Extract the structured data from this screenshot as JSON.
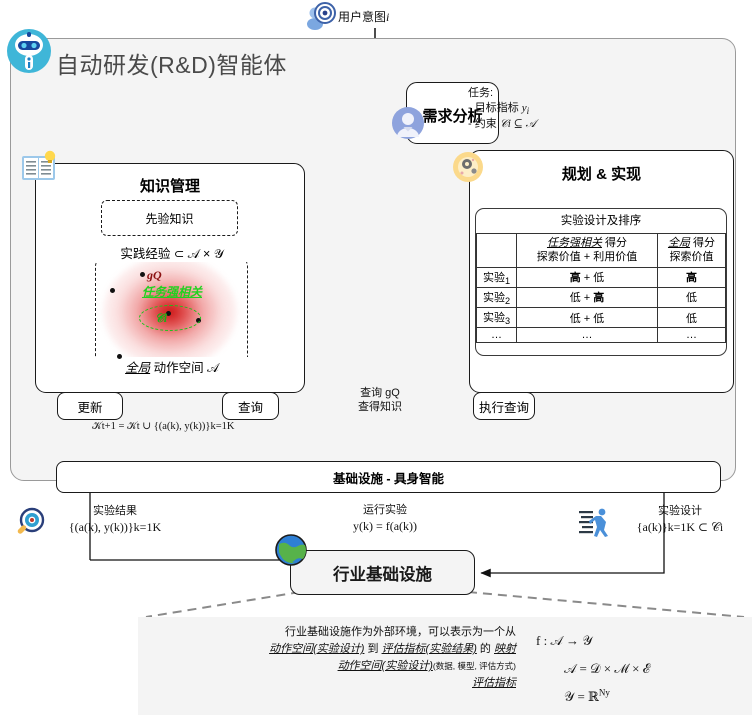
{
  "agent": {
    "title": "自动研发(R&D)智能体",
    "icon": "robot-icon"
  },
  "user_intent": {
    "label": "用户意图",
    "symbol": "i",
    "icon": "user-target-icon"
  },
  "requirement": {
    "title": "需求分析",
    "icon": "person-icon"
  },
  "task_note": {
    "line1": "任务:",
    "line2_prefix": "- 目标指标 ",
    "line2_math": "y",
    "line2_sub": "i",
    "line3_prefix": "- 约束 ",
    "line3_math": "𝒞i ⊆ 𝒜"
  },
  "knowledge": {
    "title": "知识管理",
    "icon": "book-idea-icon",
    "prior": "先验知识",
    "experience_label": "实践经验 ⊂ 𝒜 × 𝒴",
    "global_label_prefix": "全局",
    "global_label_rest": " 动作空间 𝒜",
    "task_relevant": "任务强相关",
    "constraint_symbol": "𝒞i",
    "gq_symbol": "gQ"
  },
  "actions": {
    "update": "更新",
    "query": "查询",
    "execute_query": "执行查询",
    "update_formula": "𝒦t+1 = 𝒦t ∪ {(a(k), y(k))}k=1K"
  },
  "planning": {
    "title": "规划 & 实现",
    "icon": "brain-gear-icon",
    "table": {
      "caption": "实验设计及排序",
      "headers": [
        "",
        {
          "line1_em": "任务强相关",
          "line1_rest": " 得分",
          "line2": "探索价值 + 利用价值"
        },
        {
          "line1_em": "全局",
          "line1_rest": " 得分",
          "line2": "探索价值"
        }
      ],
      "rows": [
        {
          "name": "实验",
          "sub": "1",
          "col1": [
            "高",
            "+",
            "低"
          ],
          "col1_bold": [
            true,
            false,
            false
          ],
          "col2": "高",
          "col2_bold": true
        },
        {
          "name": "实验",
          "sub": "2",
          "col1": [
            "低",
            "+",
            "高"
          ],
          "col1_bold": [
            false,
            false,
            true
          ],
          "col2": "低",
          "col2_bold": false
        },
        {
          "name": "实验",
          "sub": "3",
          "col1": [
            "低",
            "+",
            "低"
          ],
          "col1_bold": [
            false,
            false,
            false
          ],
          "col2": "低",
          "col2_bold": false
        },
        {
          "name": "…",
          "sub": "",
          "col1": [
            "…",
            "",
            ""
          ],
          "col1_bold": [
            false,
            false,
            false
          ],
          "col2": "…",
          "col2_bold": false
        }
      ]
    }
  },
  "edges": {
    "query_gq": "查询 gQ",
    "query_knowledge": "查得知识",
    "exp_result_label": "实验结果",
    "exp_result_math": "{(a(k), y(k))}k=1K",
    "run_exp_label": "运行实验",
    "run_exp_math": "y(k) = f(a(k))",
    "exp_design_label": "实验设计",
    "exp_design_math": "{a(k)}k=1K ⊂ 𝒞i"
  },
  "infra": {
    "label": "基础设施 - 具身智能"
  },
  "industry": {
    "label": "行业基础设施",
    "icon": "globe-icon"
  },
  "explain": {
    "line1": "行业基础设施作为外部环境，可以表示为一个从",
    "line2_a": "动作空间(实验设计)",
    "line2_b": " 到 ",
    "line2_c": "评估指标(实验结果)",
    "line2_d": " 的 ",
    "line2_e": "映射",
    "line3_a": "动作空间(实验设计)",
    "line3_b": "(数据, 模型, 评估方式)",
    "line4_a": "评估指标",
    "math1": "f : 𝒜 → 𝒴",
    "math2": "𝒜 = 𝒟 × ℳ × ℰ",
    "math3": "𝒴 = ℝ",
    "math3_sup": "Ny"
  },
  "icons": {
    "magnifier": "magnifier-eye-icon",
    "runner": "runner-icon"
  },
  "colors": {
    "panel_bg": "#f4f4f4",
    "accent_red": "#8b1111",
    "accent_green": "#1fd21f",
    "stroke": "#1a1a1a"
  }
}
